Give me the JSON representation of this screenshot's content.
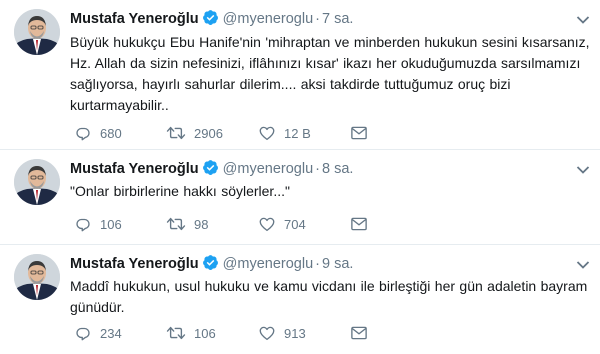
{
  "colors": {
    "verified": "#1da1f2",
    "icon_gray": "#657786",
    "divider": "#e6ecf0",
    "text": "#14171a"
  },
  "tweets": [
    {
      "name": "Mustafa Yeneroğlu",
      "handle": "@myeneroglu",
      "separator": "·",
      "time": "7 sa.",
      "text": "Büyük hukukçu Ebu Hanife'nin 'mihraptan ve minberden hukukun sesini kısarsanız, Hz. Allah da sizin nefesinizi, iflâhınızı kısar' ikazı her okuduğumuzda sarsılmamızı sağlıyorsa, hayırlı sahurlar dilerim.... aksi takdirde tuttuğumuz oruç bizi kurtarmayabilir..",
      "replies": "680",
      "retweets": "2906",
      "likes": "12 B",
      "icons": [
        "reply-icon",
        "retweet-icon",
        "like-icon",
        "direct-message-icon"
      ]
    },
    {
      "name": "Mustafa Yeneroğlu",
      "handle": "@myeneroglu",
      "separator": "·",
      "time": "8 sa.",
      "text": "\"Onlar birbirlerine hakkı söylerler...\"",
      "replies": "106",
      "retweets": "98",
      "likes": "704",
      "icons": [
        "reply-icon",
        "retweet-icon",
        "like-icon",
        "direct-message-icon"
      ]
    },
    {
      "name": "Mustafa Yeneroğlu",
      "handle": "@myeneroglu",
      "separator": "·",
      "time": "9 sa.",
      "text": "Maddî hukukun, usul hukuku ve kamu vicdanı ile birleştiği her gün adaletin bayram günüdür.",
      "replies": "234",
      "retweets": "106",
      "likes": "913",
      "icons": [
        "reply-icon",
        "retweet-icon",
        "like-icon",
        "direct-message-icon"
      ]
    }
  ]
}
